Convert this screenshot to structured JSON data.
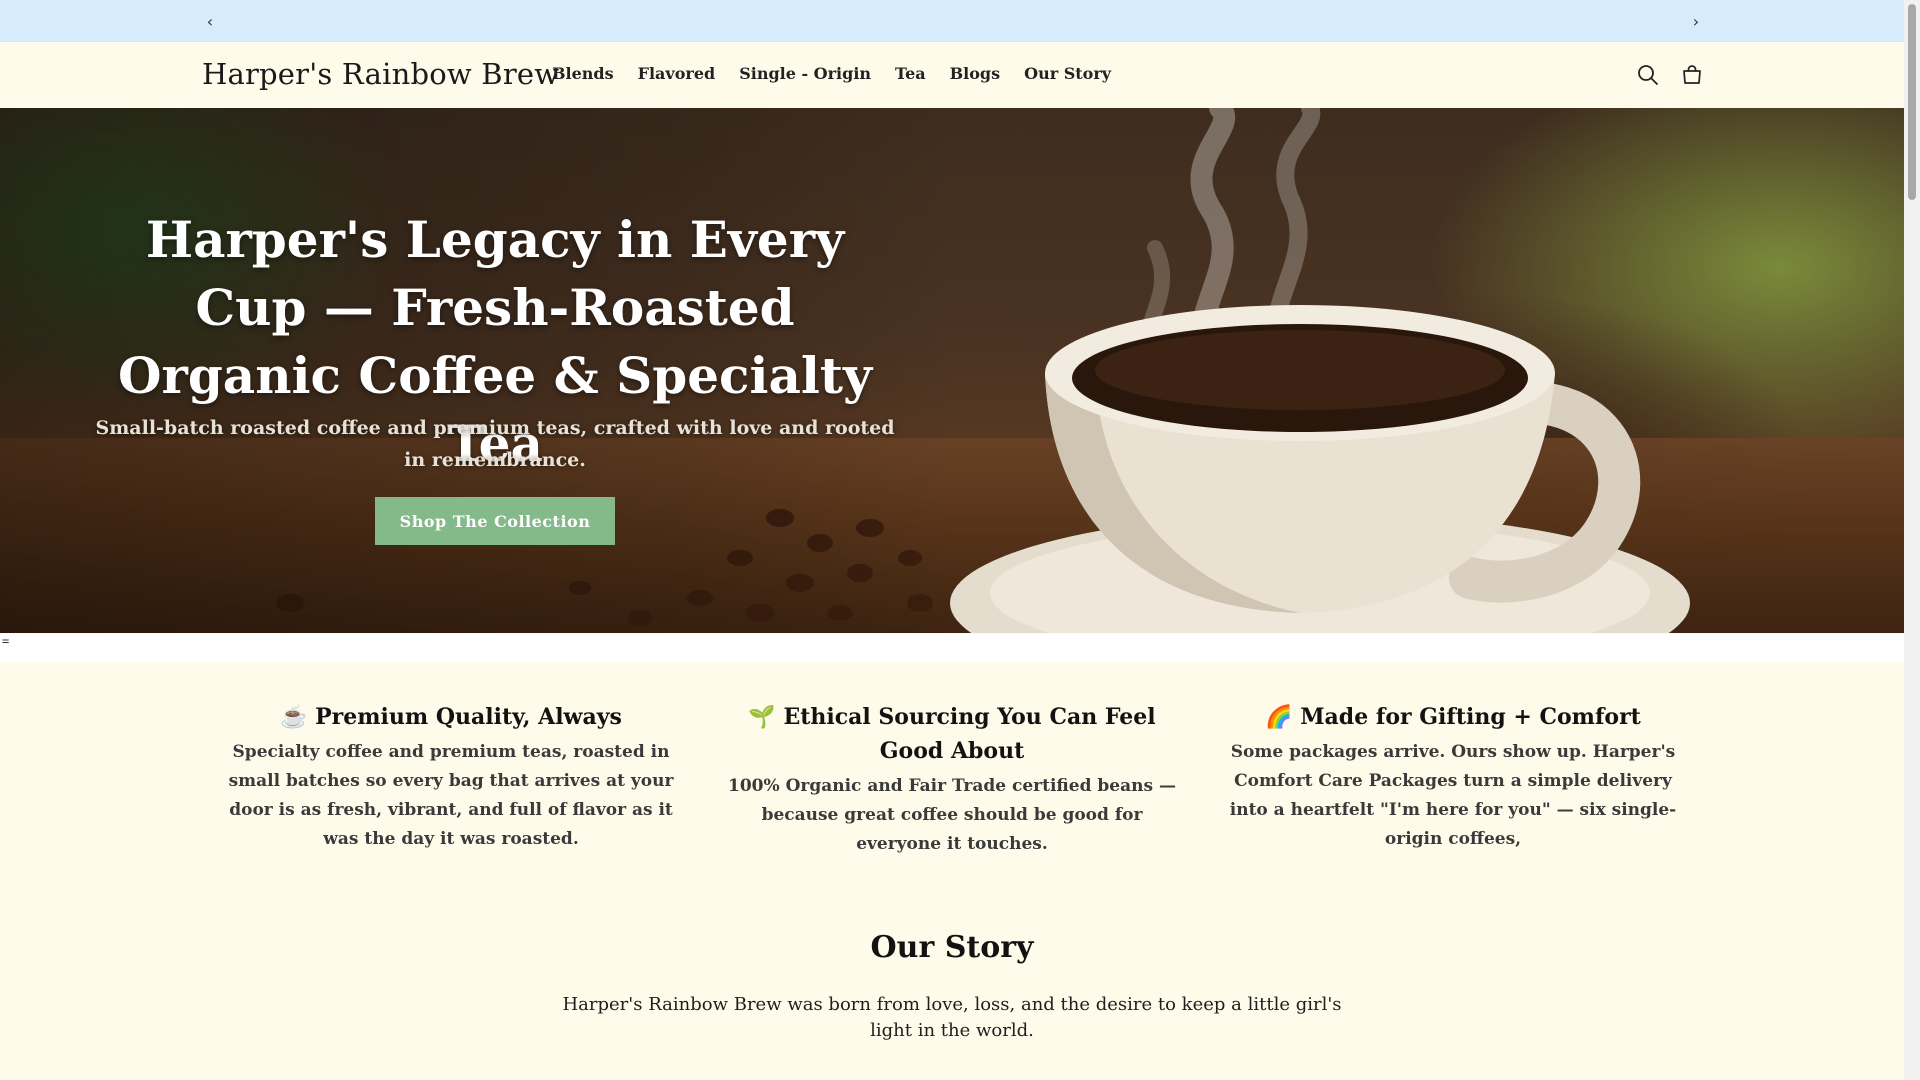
{
  "announcement": {
    "prev_label": "‹",
    "next_label": "›"
  },
  "header": {
    "logo": "Harper's Rainbow Brew",
    "nav": [
      "Blends",
      "Flavored",
      "Single - Origin",
      "Tea",
      "Blogs",
      "Our Story"
    ],
    "icons": [
      "search-icon",
      "cart-icon"
    ]
  },
  "hero": {
    "title": "Harper's Legacy in Every Cup — Fresh-Roasted Organic Coffee & Specialty Tea",
    "subtitle": "Small-batch roasted coffee and premium teas, crafted with love and rooted in remembrance.",
    "cta": "Shop The Collection"
  },
  "stray_text": "=",
  "features": [
    {
      "emoji": "☕",
      "title": "Premium Quality, Always",
      "text": "Specialty coffee and premium teas, roasted in small batches so every bag that arrives at your door is as fresh, vibrant, and full of flavor as it was the day it was roasted."
    },
    {
      "emoji": "🌱",
      "title": "Ethical Sourcing You Can Feel Good About",
      "text": "100% Organic and Fair Trade certified beans — because great coffee should be good for everyone it touches."
    },
    {
      "emoji": "🌈",
      "title": "Made for Gifting + Comfort",
      "text": "Some packages arrive. Ours show up. Harper's Comfort Care Packages turn a simple delivery into a heartfelt \"I'm here for you\" — six single-origin coffees,"
    }
  ],
  "story": {
    "title": "Our Story",
    "text": "Harper's Rainbow Brew was born from love, loss, and the desire to keep a little girl's light in the world."
  },
  "colors": {
    "announcement_bg": "#d6ecfd",
    "page_bg": "#fffbea",
    "cta_bg": "#84b98a"
  }
}
